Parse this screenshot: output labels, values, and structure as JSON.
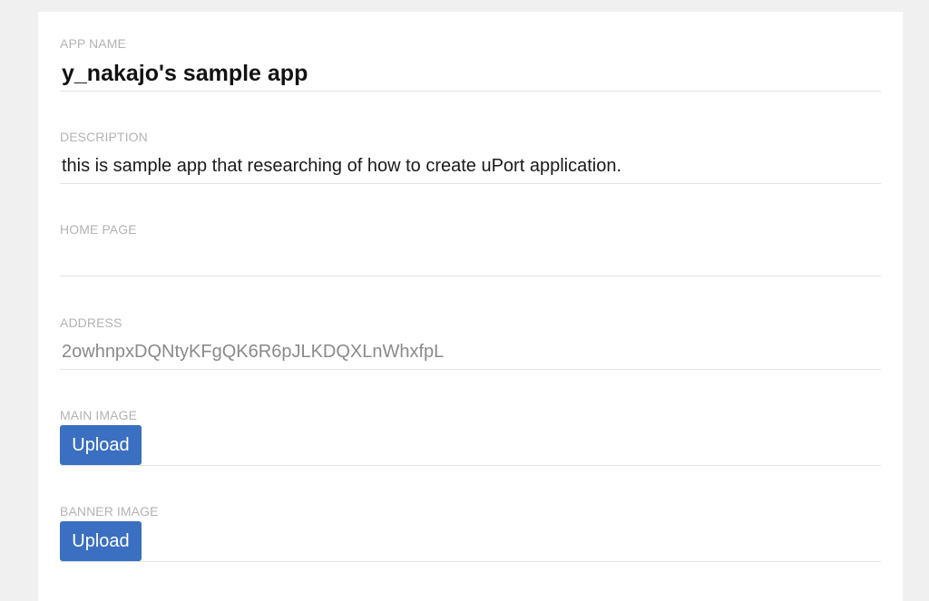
{
  "form": {
    "app_name": {
      "label": "APP NAME",
      "value": "y_nakajo's sample app"
    },
    "description": {
      "label": "DESCRIPTION",
      "value": "this is sample app that researching of how to create uPort application."
    },
    "home_page": {
      "label": "HOME PAGE",
      "value": ""
    },
    "address": {
      "label": "ADDRESS",
      "value": "2owhnpxDQNtyKFgQK6R6pJLKDQXLnWhxfpL"
    },
    "main_image": {
      "label": "MAIN IMAGE",
      "button_label": "Upload"
    },
    "banner_image": {
      "label": "BANNER IMAGE",
      "button_label": "Upload"
    }
  },
  "colors": {
    "page_background": "#f0f0f0",
    "card_background": "#ffffff",
    "label": "#b3b3b3",
    "divider": "#e3e3e3",
    "button": "#3a6fc1",
    "address_text": "#8a8a8a"
  }
}
